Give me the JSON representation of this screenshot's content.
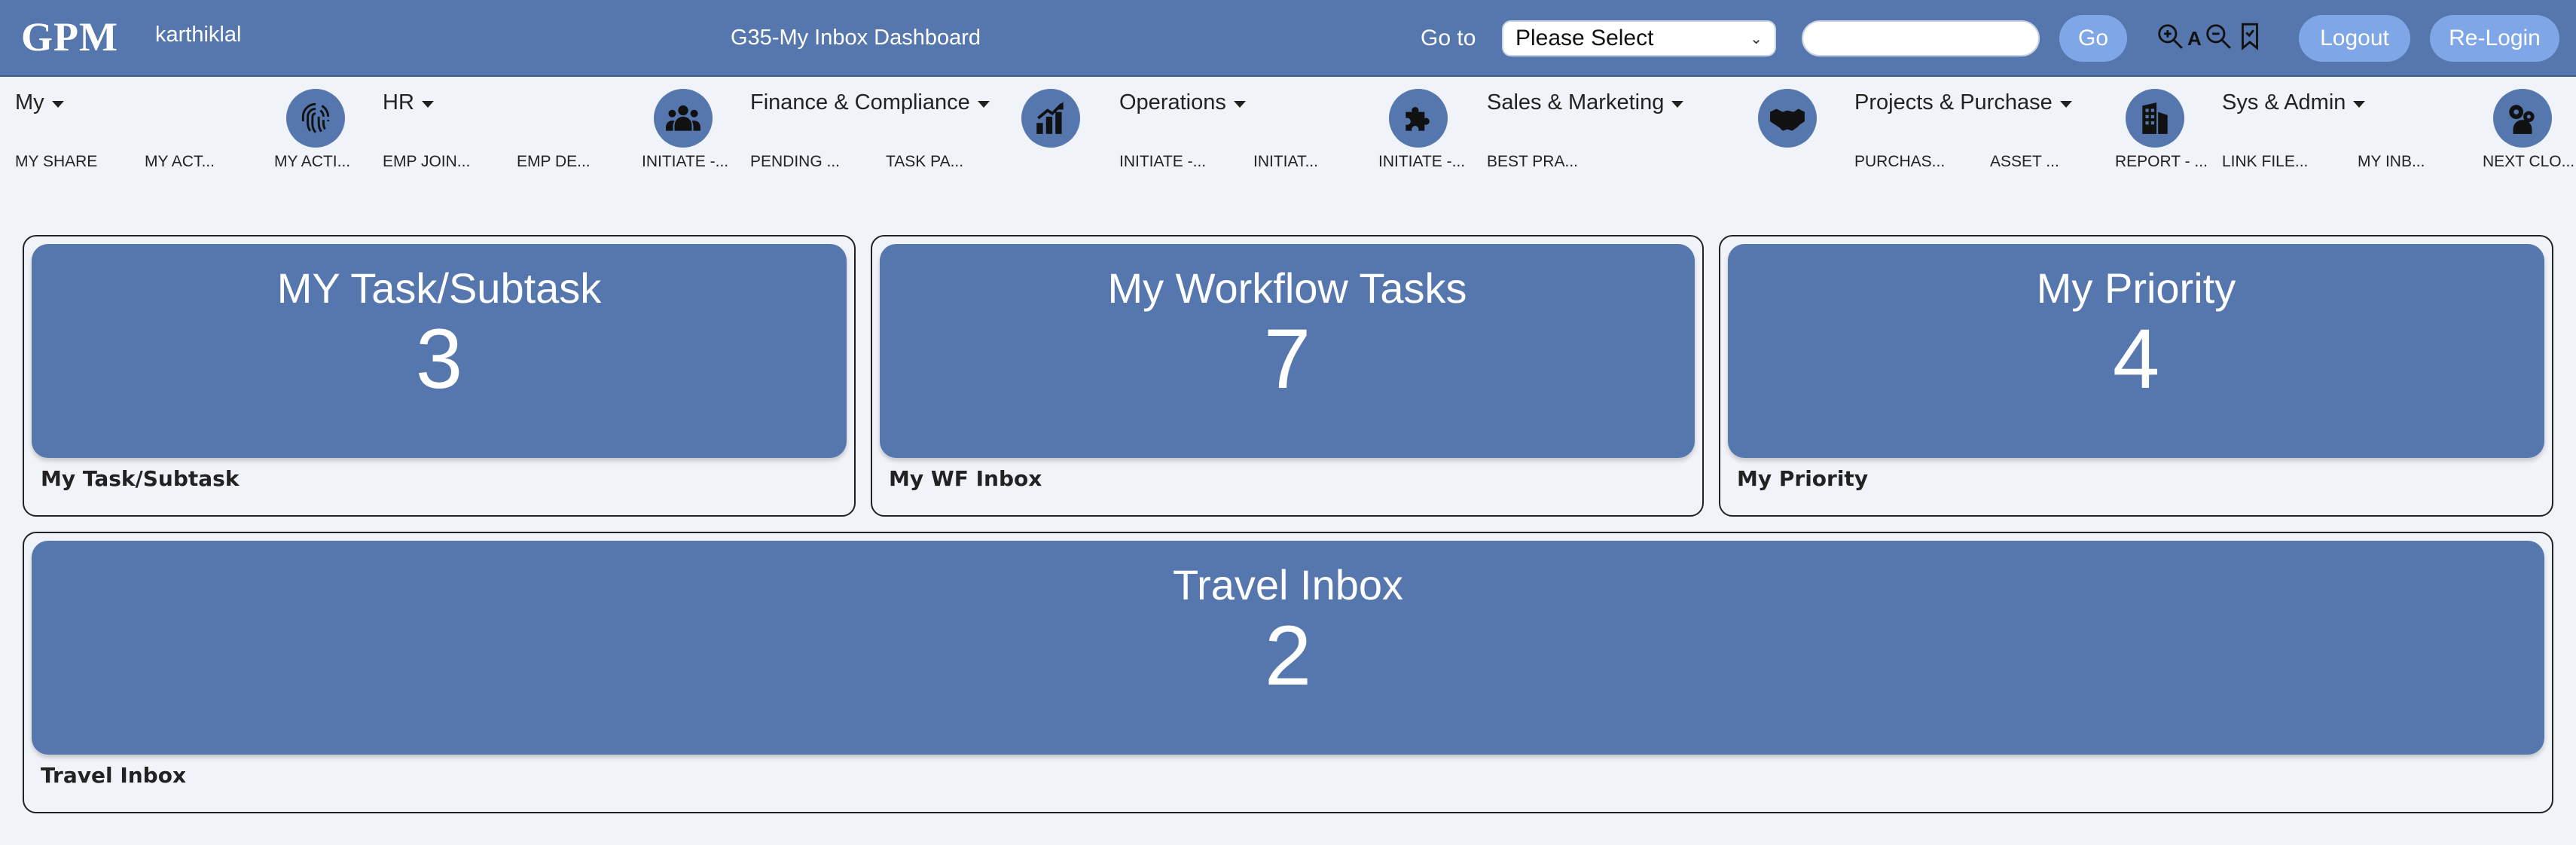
{
  "header": {
    "logo": "GPM",
    "username": "karthiklal",
    "title": "G35-My Inbox Dashboard",
    "goto_label": "Go to",
    "goto_select_value": "Please Select",
    "search_value": "",
    "go_label": "Go",
    "font_label": "A",
    "logout_label": "Logout",
    "relogin_label": "Re-Login"
  },
  "nav": {
    "menus": [
      {
        "label": "My"
      },
      {
        "label": "HR"
      },
      {
        "label": "Finance & Compliance"
      },
      {
        "label": "Operations"
      },
      {
        "label": "Sales & Marketing"
      },
      {
        "label": "Projects & Purchase"
      },
      {
        "label": "Sys & Admin"
      }
    ],
    "icons": [
      "fingerprint-icon",
      "users-group-icon",
      "bar-chart-growth-icon",
      "puzzle-icon",
      "handshake-icon",
      "building-icon",
      "gears-user-icon"
    ],
    "sublinks": [
      "MY SHARE",
      "MY ACT...",
      "MY ACTI...",
      "EMP JOIN...",
      "EMP DE...",
      "INITIATE -...",
      "PENDING ...",
      "TASK PA...",
      "INITIATE -...",
      "INITIAT...",
      "INITIATE -...",
      "BEST PRA...",
      "PURCHAS...",
      "ASSET ...",
      "REPORT - ...",
      "LINK FILE...",
      "MY INB...",
      "NEXT CLO..."
    ]
  },
  "cards": [
    {
      "title": "MY Task/Subtask",
      "count": "3",
      "footer": "My Task/Subtask"
    },
    {
      "title": "My Workflow Tasks",
      "count": "7",
      "footer": "My WF Inbox"
    },
    {
      "title": "My Priority",
      "count": "4",
      "footer": "My Priority"
    },
    {
      "title": "Travel Inbox",
      "count": "2",
      "footer": "Travel Inbox"
    }
  ],
  "colors": {
    "header_bg": "#5677ad",
    "button_bg": "#7fa6e6",
    "card_bg": "#5677ad",
    "page_bg": "#f0f3f8"
  }
}
